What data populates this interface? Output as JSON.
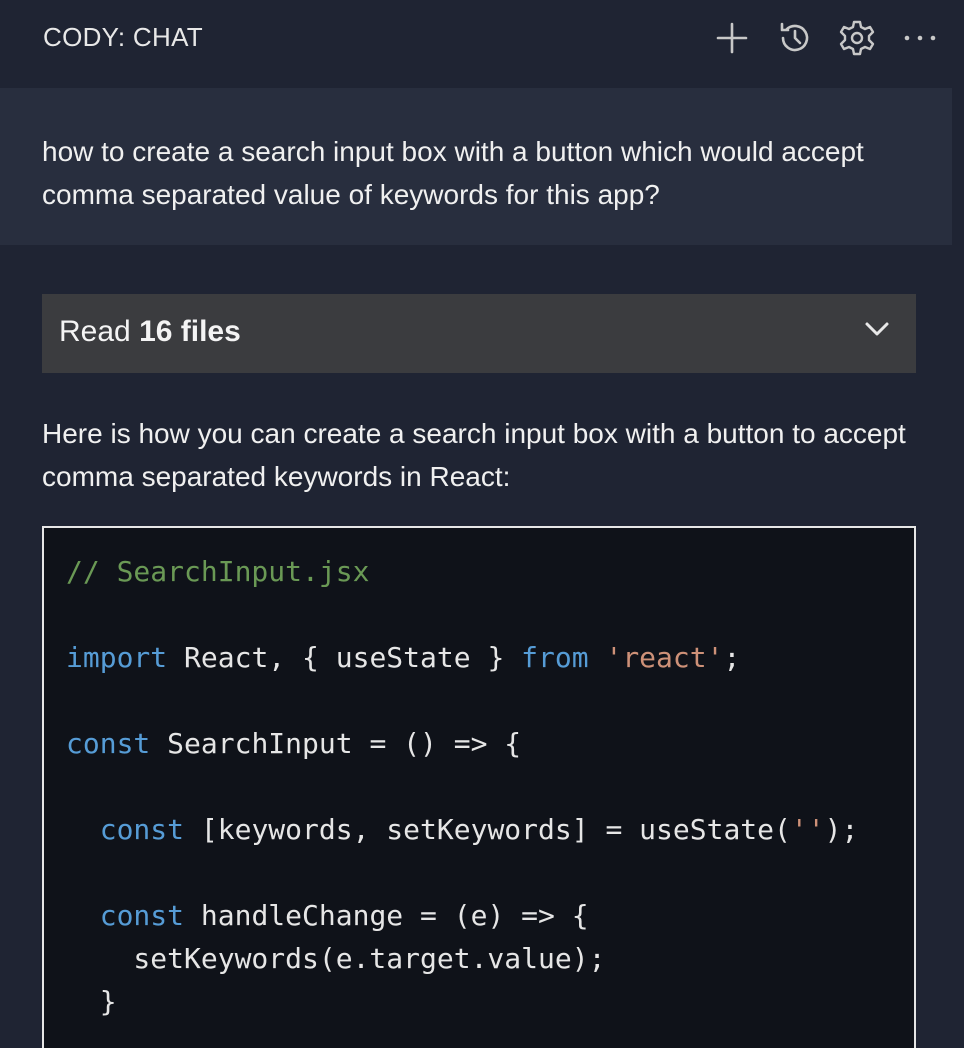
{
  "header": {
    "title": "CODY: CHAT",
    "actions": {
      "new_chat_icon": "plus-icon",
      "history_icon": "history-icon",
      "settings_icon": "gear-icon",
      "more_icon": "more-icon"
    }
  },
  "user_message": {
    "text": "how to create a search input box with a button which would accept comma separated value of keywords for this app?"
  },
  "context": {
    "prefix": "Read",
    "count_label": "16 files",
    "toggle_icon": "chevron-down-icon"
  },
  "assistant_message": {
    "text": "Here is how you can create a search input box with a button to accept comma separated keywords in React:"
  },
  "code_block": {
    "lines": [
      [
        {
          "t": "comment",
          "v": "// SearchInput.jsx"
        }
      ],
      [],
      [
        {
          "t": "keyword",
          "v": "import"
        },
        {
          "t": "plain",
          "v": " React, { useState } "
        },
        {
          "t": "keyword",
          "v": "from"
        },
        {
          "t": "plain",
          "v": " "
        },
        {
          "t": "string",
          "v": "'react'"
        },
        {
          "t": "plain",
          "v": ";"
        }
      ],
      [],
      [
        {
          "t": "keyword",
          "v": "const"
        },
        {
          "t": "plain",
          "v": " SearchInput = () => {"
        }
      ],
      [],
      [
        {
          "t": "plain",
          "v": "  "
        },
        {
          "t": "keyword",
          "v": "const"
        },
        {
          "t": "plain",
          "v": " [keywords, setKeywords] = useState("
        },
        {
          "t": "string",
          "v": "''"
        },
        {
          "t": "plain",
          "v": ");"
        }
      ],
      [],
      [
        {
          "t": "plain",
          "v": "  "
        },
        {
          "t": "keyword",
          "v": "const"
        },
        {
          "t": "plain",
          "v": " handleChange = (e) => {"
        }
      ],
      [
        {
          "t": "plain",
          "v": "    setKeywords(e.target.value);"
        }
      ],
      [
        {
          "t": "plain",
          "v": "  }"
        }
      ]
    ]
  }
}
